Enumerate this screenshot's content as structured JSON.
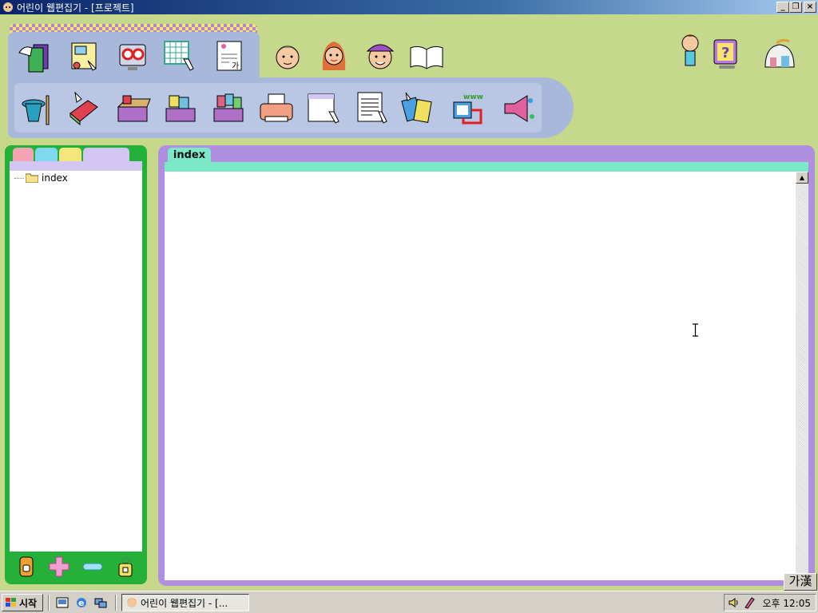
{
  "window": {
    "title": "어린이 웹편집기 - [프로젝트]",
    "buttons": {
      "minimize": "_",
      "restore": "❐",
      "close": "×"
    }
  },
  "colors": {
    "background": "#c5d88c",
    "toolbar": "#a7b8da",
    "tree_frame": "#25b03a",
    "editor_frame": "#b08fe0",
    "editor_tab": "#7de8c8"
  },
  "toolbar": {
    "top_left_icons": [
      "folder-open-icon",
      "image-edit-icon",
      "preview-monitor-icon",
      "table-grid-icon",
      "text-document-icon"
    ],
    "top_characters": [
      "character-boy-icon",
      "character-girl-icon",
      "character-cap-boy-icon",
      "book-icon"
    ],
    "top_right_icons": [
      "thinking-girl-icon",
      "help-monitor-icon",
      "home-house-icon"
    ],
    "bottom_icons": [
      "magic-hat-icon",
      "eraser-book-icon",
      "open-box-icon",
      "box-pages-icon",
      "box-colors-icon",
      "printer-icon",
      "new-page-icon",
      "page-lines-icon",
      "color-cards-icon",
      "www-monitor-icon",
      "speaker-horn-icon"
    ]
  },
  "tree": {
    "tabs": [
      "#f4a4b4",
      "#7fd8f0",
      "#f4e67a",
      "#d4c6f3"
    ],
    "items": [
      {
        "label": "index"
      }
    ],
    "bottom_icons": [
      "project-icon",
      "add-plus-icon",
      "remove-minus-icon",
      "lock-icon"
    ]
  },
  "editor": {
    "tab_label": "index",
    "scroll_up": "▲"
  },
  "ime": {
    "label": "가漢"
  },
  "taskbar": {
    "start_label": "시작",
    "task_label": "어린이 웹편집기 - [...",
    "clock": "오후 12:05"
  }
}
